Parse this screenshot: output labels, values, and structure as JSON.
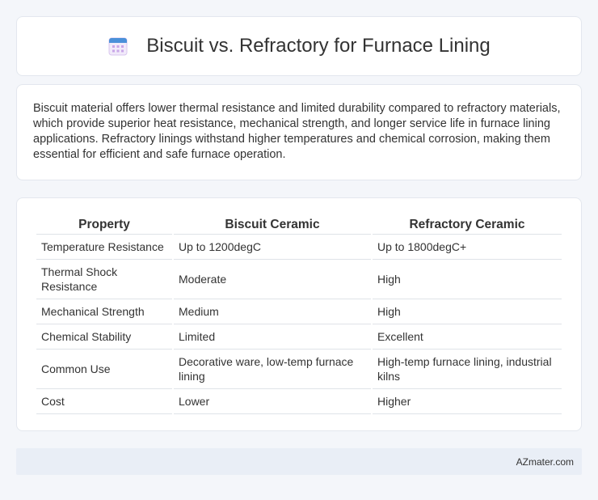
{
  "header": {
    "title": "Biscuit vs. Refractory for Furnace Lining",
    "icon": "calendar-icon",
    "icon_colors": {
      "top": "#4a90d9",
      "grid": "#c9a6e8",
      "body": "#f1eafa"
    }
  },
  "summary": {
    "text": "Biscuit material offers lower thermal resistance and limited durability compared to refractory materials, which provide superior heat resistance, mechanical strength, and longer service life in furnace lining applications. Refractory linings withstand higher temperatures and chemical corrosion, making them essential for efficient and safe furnace operation."
  },
  "table": {
    "headers": [
      "Property",
      "Biscuit Ceramic",
      "Refractory Ceramic"
    ],
    "rows": [
      [
        "Temperature Resistance",
        "Up to 1200degC",
        "Up to 1800degC+"
      ],
      [
        "Thermal Shock Resistance",
        "Moderate",
        "High"
      ],
      [
        "Mechanical Strength",
        "Medium",
        "High"
      ],
      [
        "Chemical Stability",
        "Limited",
        "Excellent"
      ],
      [
        "Common Use",
        "Decorative ware, low-temp furnace lining",
        "High-temp furnace lining, industrial kilns"
      ],
      [
        "Cost",
        "Lower",
        "Higher"
      ]
    ]
  },
  "footer": {
    "brand": "AZmater.com"
  }
}
